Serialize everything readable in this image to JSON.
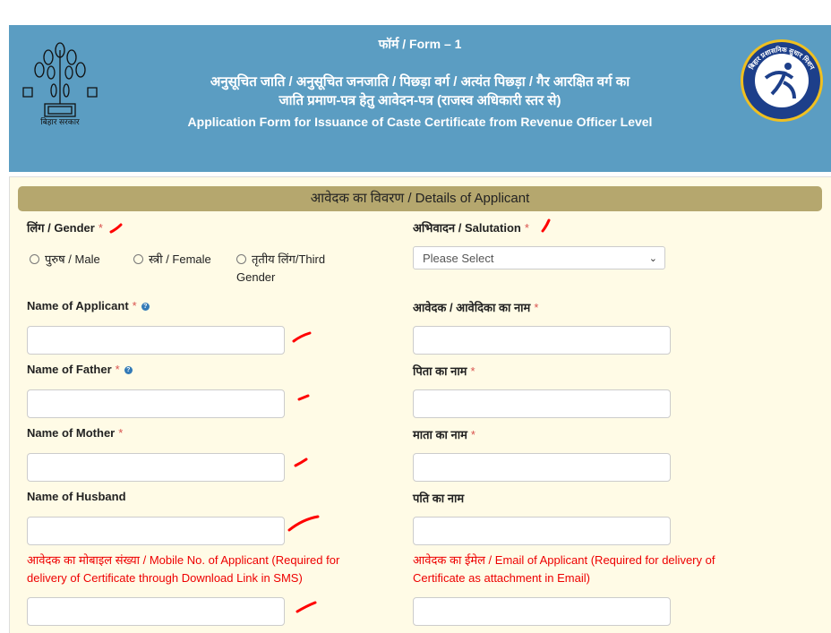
{
  "header": {
    "form_no": "फॉर्म / Form – 1",
    "title_hi_1": "अनुसूचित जाति / अनुसूचित जनजाति / पिछड़ा वर्ग / अत्यंत पिछड़ा / गैर आरक्षित वर्ग का",
    "title_hi_2": "जाति प्रमाण-पत्र हेतु आवेदन-पत्र (राजस्व अधिकारी स्तर से)",
    "title_en": "Application Form for Issuance of Caste Certificate from Revenue Officer Level",
    "left_logo_text": "बिहार सरकार",
    "right_logo_text": "बिहार प्रशासनिक सुधार मिशन"
  },
  "section": {
    "title": "आवेदक का विवरण / Details of Applicant"
  },
  "colors": {
    "header": "#5b9dc2",
    "section": "#b5a76e",
    "background": "#fffbe6",
    "required": "#d9534f",
    "annotation": "#ff0000"
  },
  "fields": {
    "gender": {
      "label": "लिंग / Gender",
      "req": "*",
      "options": [
        "पुरुष / Male",
        "स्त्री / Female",
        "तृतीय लिंग/Third Gender"
      ]
    },
    "salutation": {
      "label": "अभिवादन / Salutation",
      "req": "*",
      "value": "Please Select"
    },
    "name_en": {
      "label": "Name of Applicant",
      "req": "*",
      "value": ""
    },
    "name_hi": {
      "label": "आवेदक / आवेदिका का नाम",
      "req": "*",
      "value": ""
    },
    "father_en": {
      "label": "Name of Father",
      "req": "*",
      "value": ""
    },
    "father_hi": {
      "label": "पिता का नाम",
      "req": "*",
      "value": ""
    },
    "mother_en": {
      "label": "Name of Mother",
      "req": "*",
      "value": ""
    },
    "mother_hi": {
      "label": "माता का नाम",
      "req": "*",
      "value": ""
    },
    "husband_en": {
      "label": "Name of Husband",
      "value": ""
    },
    "husband_hi": {
      "label": "पति का नाम",
      "value": ""
    },
    "mobile": {
      "label": "आवेदक का मोबाइल संख्या / Mobile No. of Applicant (Required for delivery of Certificate through Download Link in SMS)",
      "value": ""
    },
    "email": {
      "label": "आवेदक का ईमेल / Email of Applicant (Required for delivery of Certificate as attachment in Email)",
      "value": ""
    }
  }
}
